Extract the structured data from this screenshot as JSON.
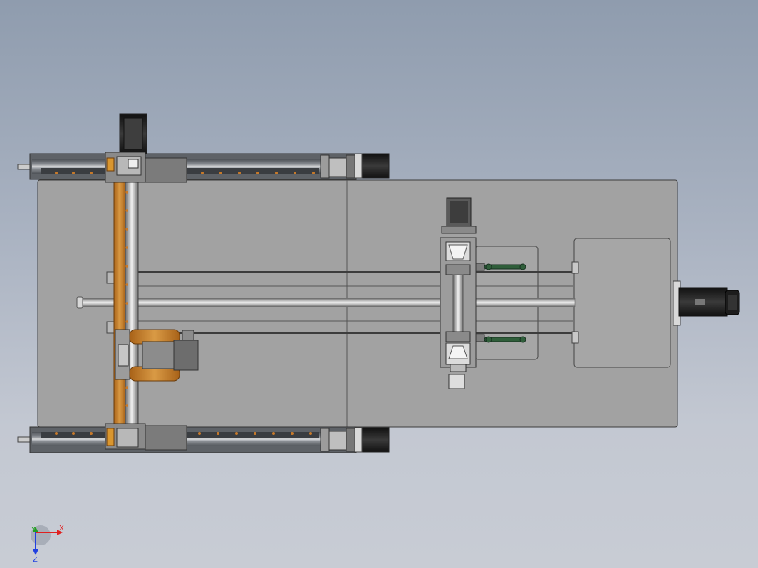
{
  "view": {
    "background_top": "#8f9cae",
    "background_bottom": "#c8ccd4"
  },
  "colors": {
    "base_plate": "#a3a3a3",
    "outline": "#3c3c3c",
    "rail_body": "#6f7378",
    "rail_slot": "#c9c9c9",
    "gantry_orange": "#c8822a",
    "motor_dark": "#2a2a2a",
    "hose_green": "#2f5e3a",
    "axis_x": "#e02020",
    "axis_y": "#20a020",
    "axis_z": "#2040e0"
  },
  "axis_triad": {
    "x_label": "X",
    "y_label": "Y",
    "z_label": "Z"
  },
  "icons": [
    "coordinate-triad-icon"
  ]
}
